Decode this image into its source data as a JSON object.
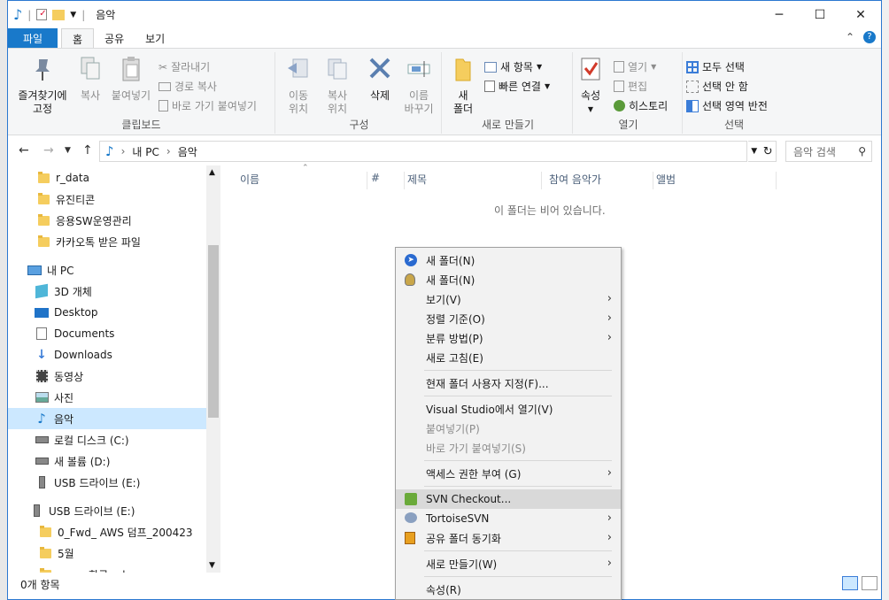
{
  "window": {
    "title": "음악"
  },
  "ribbon_tabs": [
    "파일",
    "홈",
    "공유",
    "보기"
  ],
  "ribbon": {
    "clipboard": {
      "label": "클립보드",
      "pin": "즐겨찾기에\n고정",
      "copy": "복사",
      "paste": "붙여넣기",
      "cut": "잘라내기",
      "copy_path": "경로 복사",
      "paste_shortcut": "바로 가기 붙여넣기"
    },
    "organize": {
      "label": "구성",
      "move": "이동\n위치",
      "copy_to": "복사\n위치",
      "delete": "삭제",
      "rename": "이름\n바꾸기"
    },
    "new": {
      "label": "새로 만들기",
      "new_folder": "새\n폴더",
      "new_item": "새 항목",
      "easy_access": "빠른 연결"
    },
    "open": {
      "label": "열기",
      "properties": "속성",
      "open": "열기",
      "edit": "편집",
      "history": "히스토리"
    },
    "select": {
      "label": "선택",
      "select_all": "모두 선택",
      "select_none": "선택 안 함",
      "invert": "선택 영역 반전"
    }
  },
  "address": {
    "path": [
      "내 PC",
      "음악"
    ],
    "search_placeholder": "음악 검색"
  },
  "nav": [
    {
      "label": "r_data",
      "icon": "folder"
    },
    {
      "label": "유진티콘",
      "icon": "folder"
    },
    {
      "label": "응용SW운영관리",
      "icon": "folder"
    },
    {
      "label": "카카오톡 받은 파일",
      "icon": "folder"
    },
    {
      "label": "내 PC",
      "icon": "pc"
    },
    {
      "label": "3D 개체",
      "icon": "cube"
    },
    {
      "label": "Desktop",
      "icon": "desktop"
    },
    {
      "label": "Documents",
      "icon": "documents"
    },
    {
      "label": "Downloads",
      "icon": "downloads"
    },
    {
      "label": "동영상",
      "icon": "video"
    },
    {
      "label": "사진",
      "icon": "pictures"
    },
    {
      "label": "음악",
      "icon": "music"
    },
    {
      "label": "로컬 디스크 (C:)",
      "icon": "drive"
    },
    {
      "label": "새 볼륨 (D:)",
      "icon": "drive"
    },
    {
      "label": "USB 드라이브 (E:)",
      "icon": "usb"
    },
    {
      "label": "USB 드라이브 (E:)",
      "icon": "usb"
    },
    {
      "label": "0_Fwd_ AWS 덤프_200423",
      "icon": "folder"
    },
    {
      "label": "5월",
      "icon": "folder"
    },
    {
      "label": "aws : 한국 : dump",
      "icon": "folder"
    }
  ],
  "columns": [
    "이름",
    "#",
    "제목",
    "참여 음악가",
    "앨범"
  ],
  "empty_message": "이 폴더는 비어 있습니다.",
  "status": {
    "count": "0개 항목"
  },
  "context_menu": [
    {
      "label": "새 폴더(N)",
      "icon": "tortoise-blue-icon"
    },
    {
      "label": "새 폴더(N)",
      "icon": "bulb-icon"
    },
    {
      "label": "보기(V)",
      "submenu": true
    },
    {
      "label": "정렬 기준(O)",
      "submenu": true
    },
    {
      "label": "분류 방법(P)",
      "submenu": true
    },
    {
      "label": "새로 고침(E)"
    },
    {
      "label": "현재 폴더 사용자 지정(F)..."
    },
    {
      "label": "Visual Studio에서 열기(V)"
    },
    {
      "label": "붙여넣기(P)",
      "disabled": true
    },
    {
      "label": "바로 가기 붙여넣기(S)",
      "disabled": true
    },
    {
      "label": "액세스 권한 부여 (G)",
      "submenu": true
    },
    {
      "label": "SVN Checkout...",
      "icon": "svn-checkout-icon",
      "highlighted": true
    },
    {
      "label": "TortoiseSVN",
      "icon": "tortoise-icon",
      "submenu": true
    },
    {
      "label": "공유 폴더 동기화",
      "icon": "sync-icon",
      "submenu": true
    },
    {
      "label": "새로 만들기(W)",
      "submenu": true
    },
    {
      "label": "속성(R)"
    }
  ]
}
